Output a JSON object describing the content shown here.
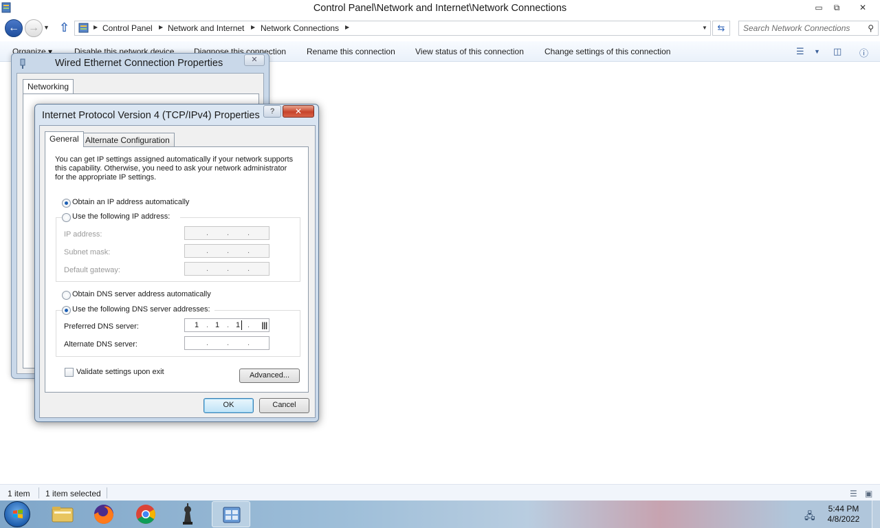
{
  "window": {
    "title": "Control Panel\\Network and Internet\\Network Connections",
    "minimize_glyph": "▭",
    "maximize_glyph": "⧉",
    "close_glyph": "✕"
  },
  "address": {
    "crumbs": [
      "Control Panel",
      "Network and Internet",
      "Network Connections"
    ],
    "search_placeholder": "Search Network Connections"
  },
  "toolbar": {
    "organize": "Organize ▾",
    "disable": "Disable this network device",
    "diagnose": "Diagnose this connection",
    "rename": "Rename this connection",
    "view_status": "View status of this connection",
    "change_settings": "Change settings of this connection"
  },
  "status": {
    "count": "1 item",
    "selected": "1 item selected"
  },
  "taskbar": {
    "time": "5:44 PM",
    "date": "4/8/2022",
    "apps": [
      "windows-explorer",
      "firefox",
      "chrome",
      "chess-app",
      "control-panel"
    ]
  },
  "bg_dialog": {
    "title": "Wired Ethernet Connection Properties",
    "tab": "Networking"
  },
  "dialog": {
    "title": "Internet Protocol Version 4 (TCP/IPv4) Properties",
    "help": "?",
    "close": "✕",
    "tabs": {
      "general": "General",
      "alternate": "Alternate Configuration"
    },
    "intro": "You can get IP settings assigned automatically if your network supports this capability. Otherwise, you need to ask your network administrator for the appropriate IP settings.",
    "ip_auto": "Obtain an IP address automatically",
    "ip_manual": "Use the following IP address:",
    "ip_address_label": "IP address:",
    "subnet_label": "Subnet mask:",
    "gateway_label": "Default gateway:",
    "dns_auto": "Obtain DNS server address automatically",
    "dns_manual": "Use the following DNS server addresses:",
    "preferred_dns_label": "Preferred DNS server:",
    "preferred_dns_octets": [
      "1",
      "1",
      "1",
      ""
    ],
    "alternate_dns_label": "Alternate DNS server:",
    "validate_label": "Validate settings upon exit",
    "validate_checked": false,
    "ip_mode": "automatic",
    "dns_mode": "manual",
    "advanced": "Advanced...",
    "ok": "OK",
    "cancel": "Cancel"
  },
  "colors": {
    "accent": "#1c5fb4",
    "close_red": "#c7432a",
    "toolbar_bg": "#eaf1fa"
  }
}
